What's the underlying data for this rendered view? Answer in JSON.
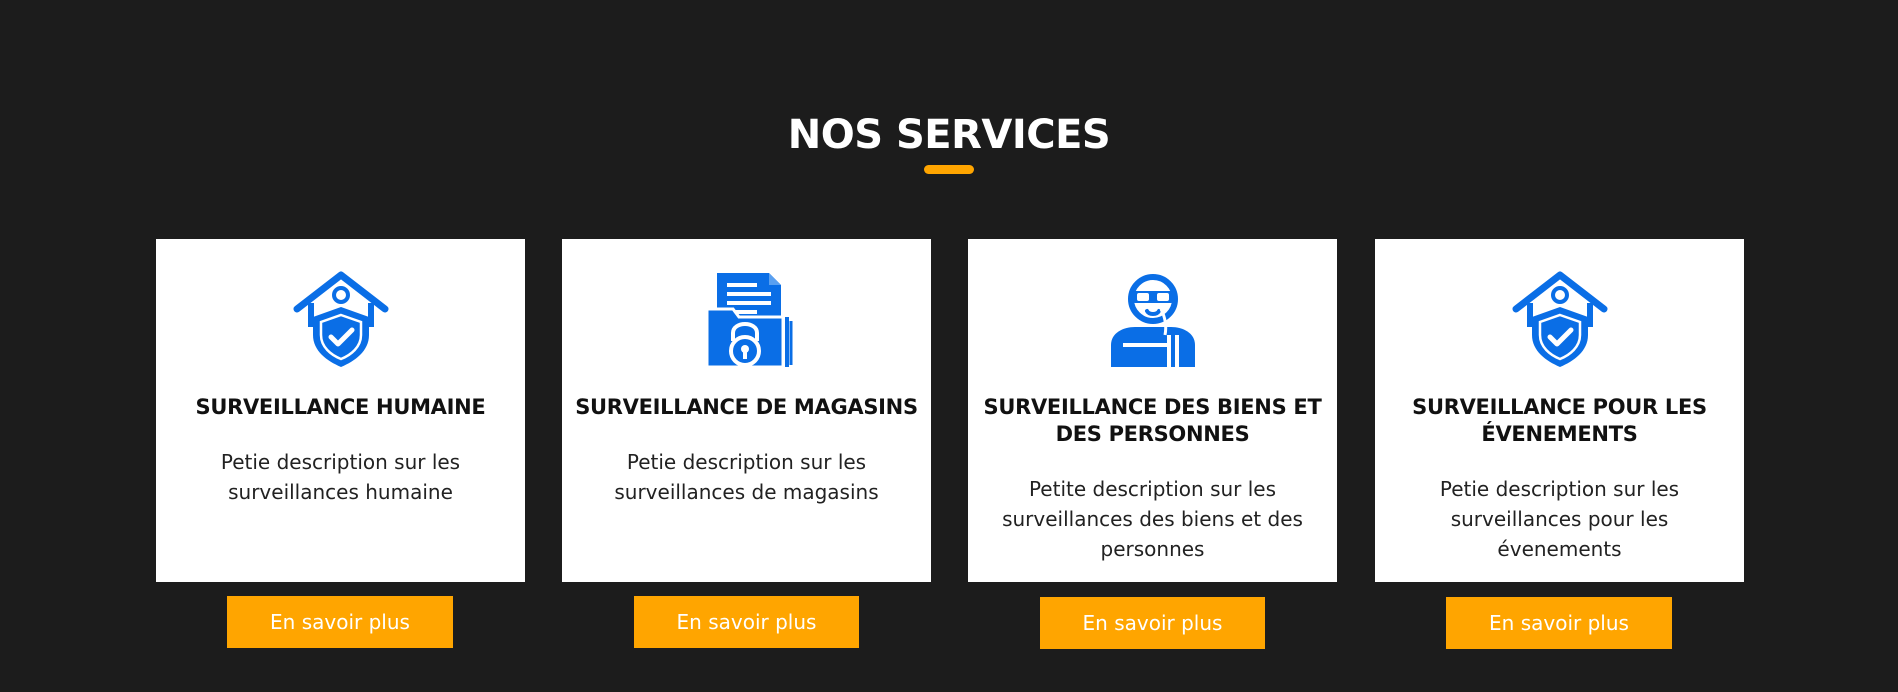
{
  "section": {
    "title": "NOS SERVICES",
    "accent_color": "#ffa500",
    "icon_color": "#0a6ee6",
    "background_color": "#1c1c1c"
  },
  "services": [
    {
      "icon": "house-shield-icon",
      "title": "SURVEILLANCE HUMAINE",
      "description": "Petie description sur les surveillances humaine",
      "button_label": "En savoir plus"
    },
    {
      "icon": "folder-lock-icon",
      "title": "SURVEILLANCE DE MAGASINS",
      "description": "Petie description sur les surveillances de magasins",
      "button_label": "En savoir plus"
    },
    {
      "icon": "security-guard-icon",
      "title": "SURVEILLANCE DES BIENS ET DES PERSONNES",
      "description": "Petite description sur les surveillances des biens et des personnes",
      "button_label": "En savoir plus"
    },
    {
      "icon": "house-shield-icon",
      "title": "SURVEILLANCE POUR LES ÉVENEMENTS",
      "description": "Petie description sur les surveillances pour les évenements",
      "button_label": "En savoir plus"
    }
  ]
}
